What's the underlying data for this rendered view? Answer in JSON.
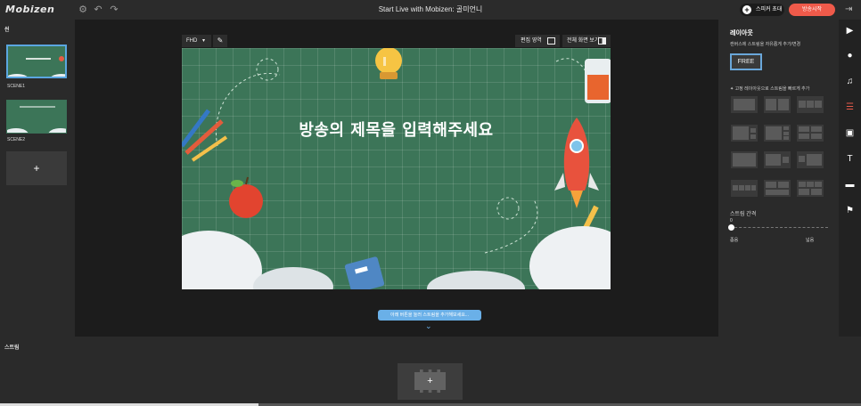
{
  "topbar": {
    "logo": "Mobizen",
    "title": "Start Live with Mobizen: 골미언니",
    "invite_label": "스피커 초대",
    "live_label": "방송시작"
  },
  "scenes": {
    "panel_label": "씬",
    "items": [
      {
        "name": "SCENE1"
      },
      {
        "name": "SCENE2"
      }
    ],
    "add_label": "+"
  },
  "canvas": {
    "resolution": "FHD",
    "edit_ratio_label": "편집 영역",
    "fullscreen_label": "전체 화면 보기",
    "stage_title": "방송의 제목을 입력해주세요",
    "hint": "아래 버튼을 눌러 스트림을 추가해보세요..."
  },
  "layout_panel": {
    "title": "레이아웃",
    "description": "캔버스에 스트림을 자유롭게 추가/변경",
    "free_label": "FREE",
    "description2": "✦ 고정 레이아웃으로 스트림을 빠르게 추가",
    "stream_gap_label": "스트림 간격",
    "gap_value": "0",
    "gap_narrow": "좁음",
    "gap_wide": "넓음"
  },
  "stream_panel": {
    "label": "스트림",
    "add_label": "+"
  },
  "colors": {
    "accent": "#ef5a4a",
    "chalkboard": "#3c7558",
    "selection": "#5aa6e0"
  }
}
